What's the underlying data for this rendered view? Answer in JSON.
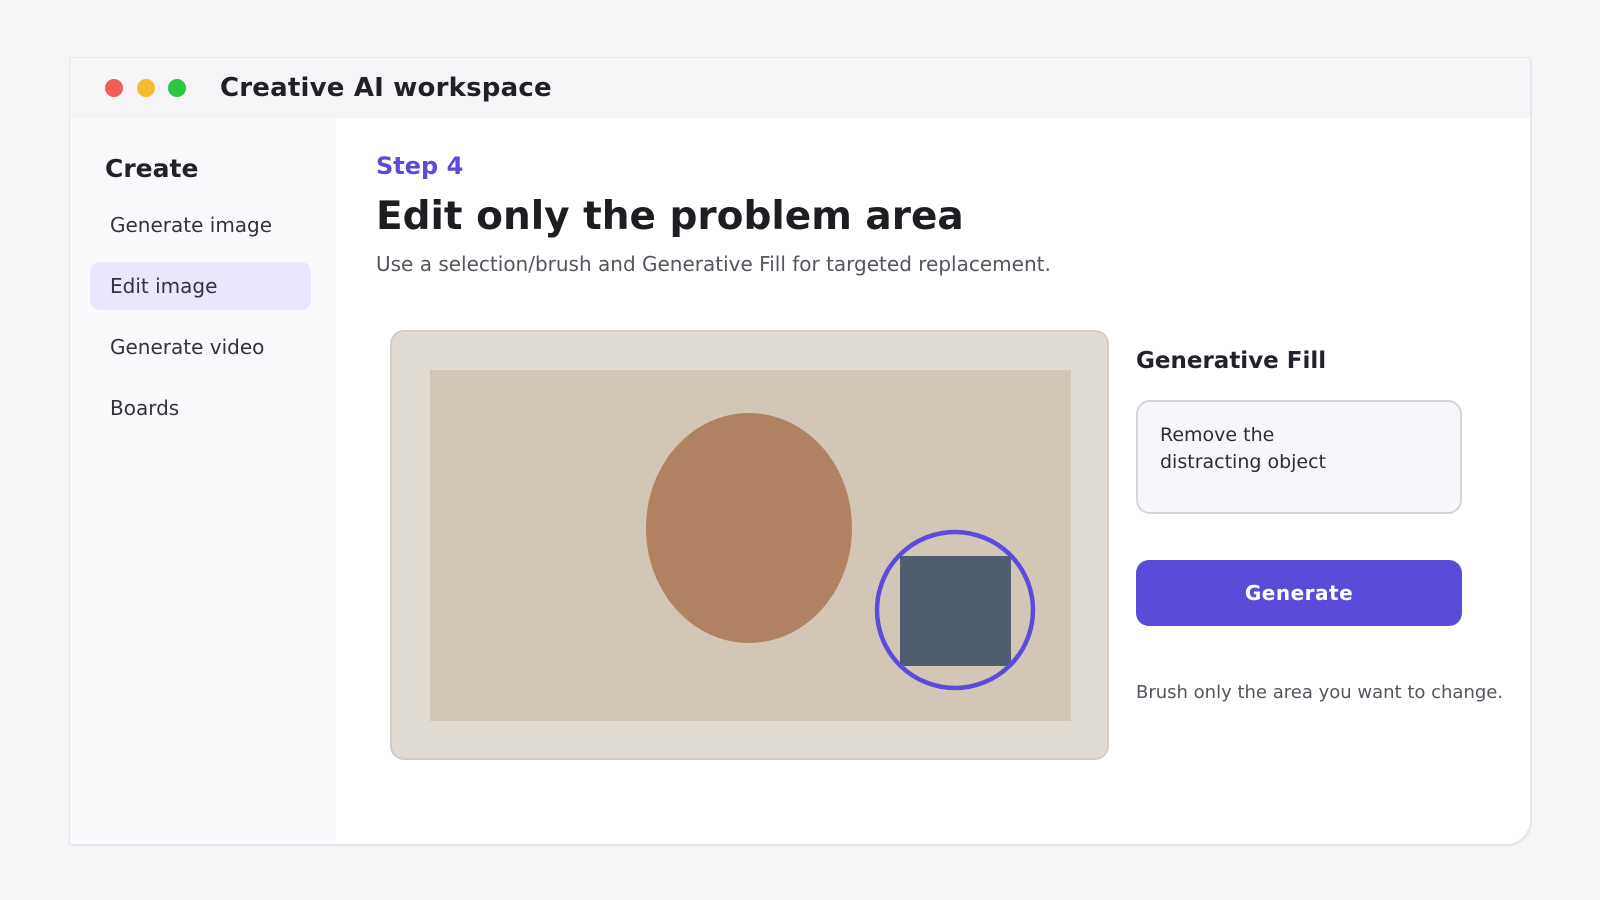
{
  "window": {
    "title": "Creative AI workspace"
  },
  "sidebar": {
    "heading": "Create",
    "items": [
      {
        "label": "Generate image",
        "active": false
      },
      {
        "label": "Edit image",
        "active": true
      },
      {
        "label": "Generate video",
        "active": false
      },
      {
        "label": "Boards",
        "active": false
      }
    ]
  },
  "main": {
    "step": "Step 4",
    "heading": "Edit only the problem area",
    "subtitle": "Use a selection/brush and Generative Fill for targeted replacement."
  },
  "generative_fill": {
    "title": "Generative Fill",
    "prompt": "Remove the\ndistracting object",
    "button_label": "Generate",
    "hint": "Brush only the area you want to change."
  },
  "colors": {
    "accent": "#5b4bd9",
    "canvas_frame": "#e0dbd3",
    "image_background": "#d2c6b6",
    "subject_ellipse": "#b08262",
    "distracting_object": "#505d6e",
    "selection_ring": "#5b4bd9"
  }
}
